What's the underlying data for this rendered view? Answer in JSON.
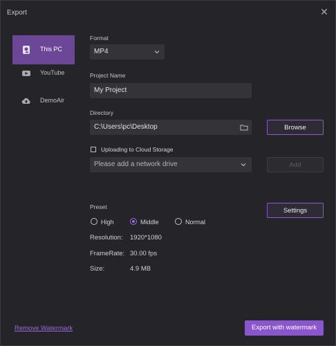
{
  "window": {
    "title": "Export",
    "close_glyph": "✕"
  },
  "sidebar": {
    "items": [
      {
        "label": "This PC",
        "icon": "this-pc-icon",
        "active": true
      },
      {
        "label": "YouTube",
        "icon": "youtube-icon",
        "active": false
      },
      {
        "label": "DemoAir",
        "icon": "cloud-upload-icon",
        "active": false
      }
    ]
  },
  "format": {
    "label": "Format",
    "value": "MP4"
  },
  "project": {
    "label": "Project Name",
    "value": "My Project"
  },
  "directory": {
    "label": "Directory",
    "value": "C:\\Users\\pc\\Desktop",
    "browse_label": "Browse"
  },
  "cloud": {
    "checkbox_label": "Uploading to Cloud Storage",
    "checked": false,
    "drive_placeholder": "Please add a network drive",
    "add_label": "Add"
  },
  "preset": {
    "label": "Preset",
    "options": [
      {
        "label": "High",
        "checked": false
      },
      {
        "label": "Middle",
        "checked": true
      },
      {
        "label": "Normal",
        "checked": false
      }
    ],
    "settings_label": "Settings"
  },
  "info": {
    "resolution_label": "Resolution:",
    "resolution_value": "1920*1080",
    "framerate_label": "FrameRate:",
    "framerate_value": "30.00 fps",
    "size_label": "Size:",
    "size_value": "4.9 MB"
  },
  "footer": {
    "remove_watermark": "Remove Watermark",
    "export_label": "Export with watermark"
  },
  "colors": {
    "accent": "#8b55d0",
    "active_tab": "#6c4797",
    "background": "#252529",
    "field": "#343438"
  }
}
